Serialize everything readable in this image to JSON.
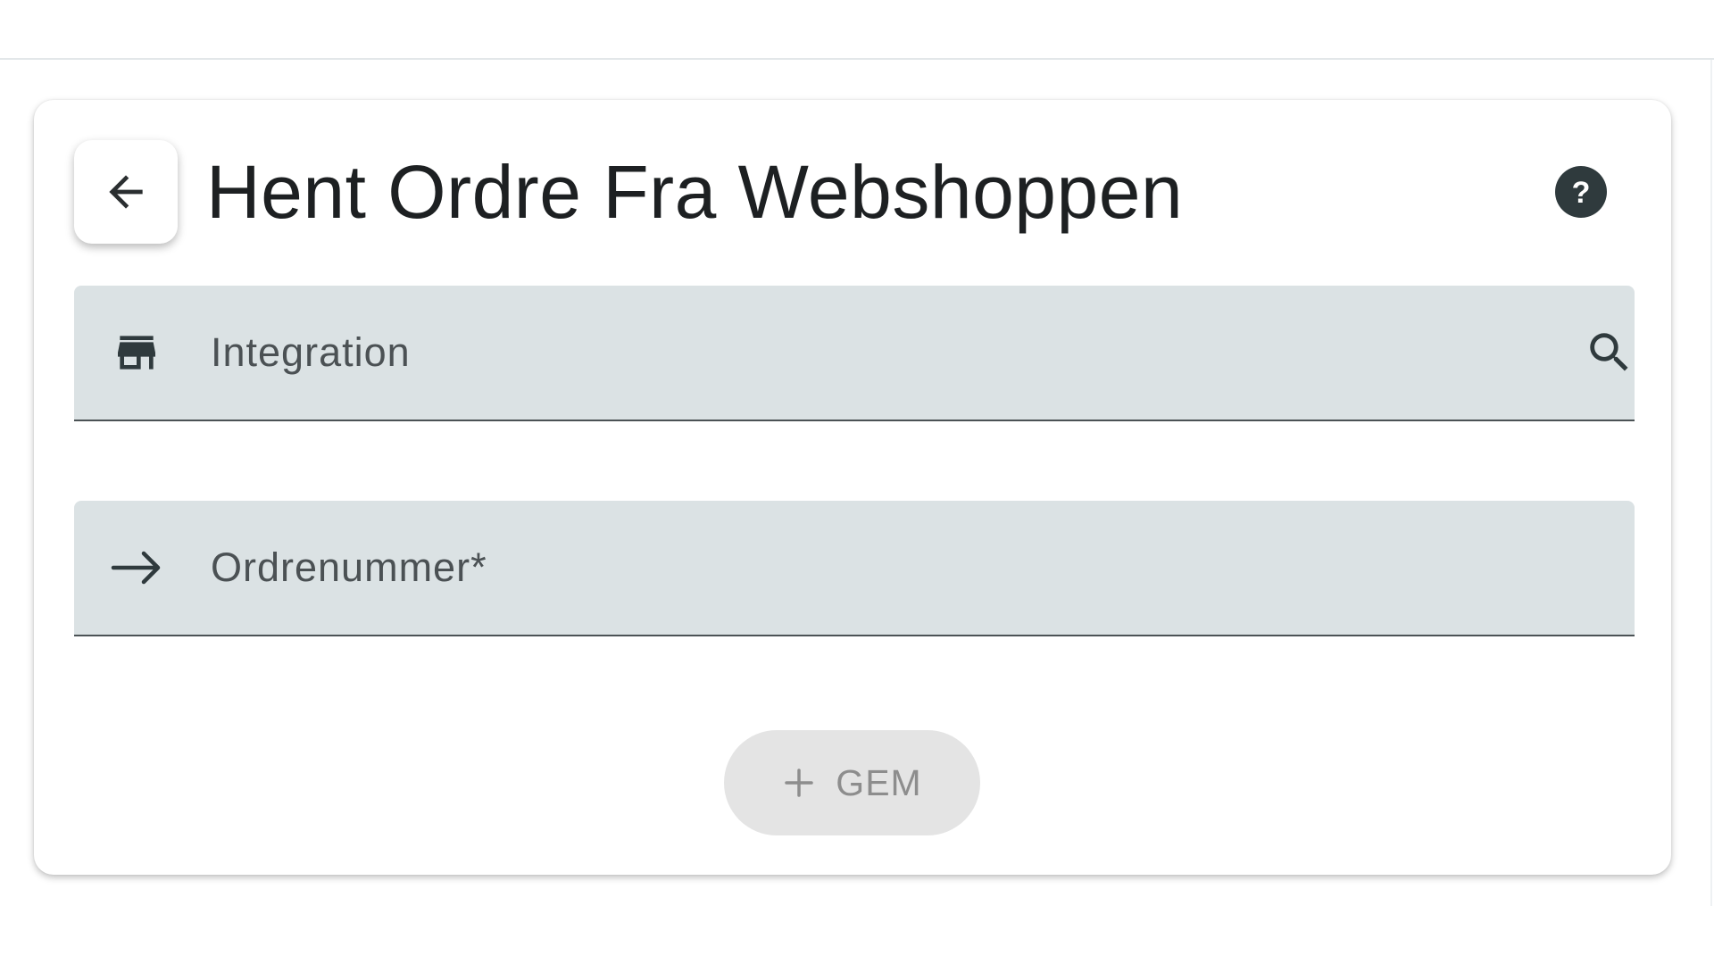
{
  "header": {
    "title": "Hent Ordre Fra Webshoppen",
    "back_icon": "arrow-left-icon",
    "help_icon": "help-circle-icon"
  },
  "form": {
    "integration": {
      "label": "Integration",
      "leading_icon": "store-icon",
      "trailing_icon": "search-icon"
    },
    "order_number": {
      "label": "Ordrenummer*",
      "leading_icon": "arrow-right-icon"
    }
  },
  "actions": {
    "save_label": "GEM",
    "save_icon": "plus-icon",
    "save_disabled": true
  },
  "colors": {
    "field_background": "#dbe2e4",
    "title_text": "#1d2022",
    "disabled_button": "#e4e4e4",
    "help_icon": "#2f3a3d"
  }
}
